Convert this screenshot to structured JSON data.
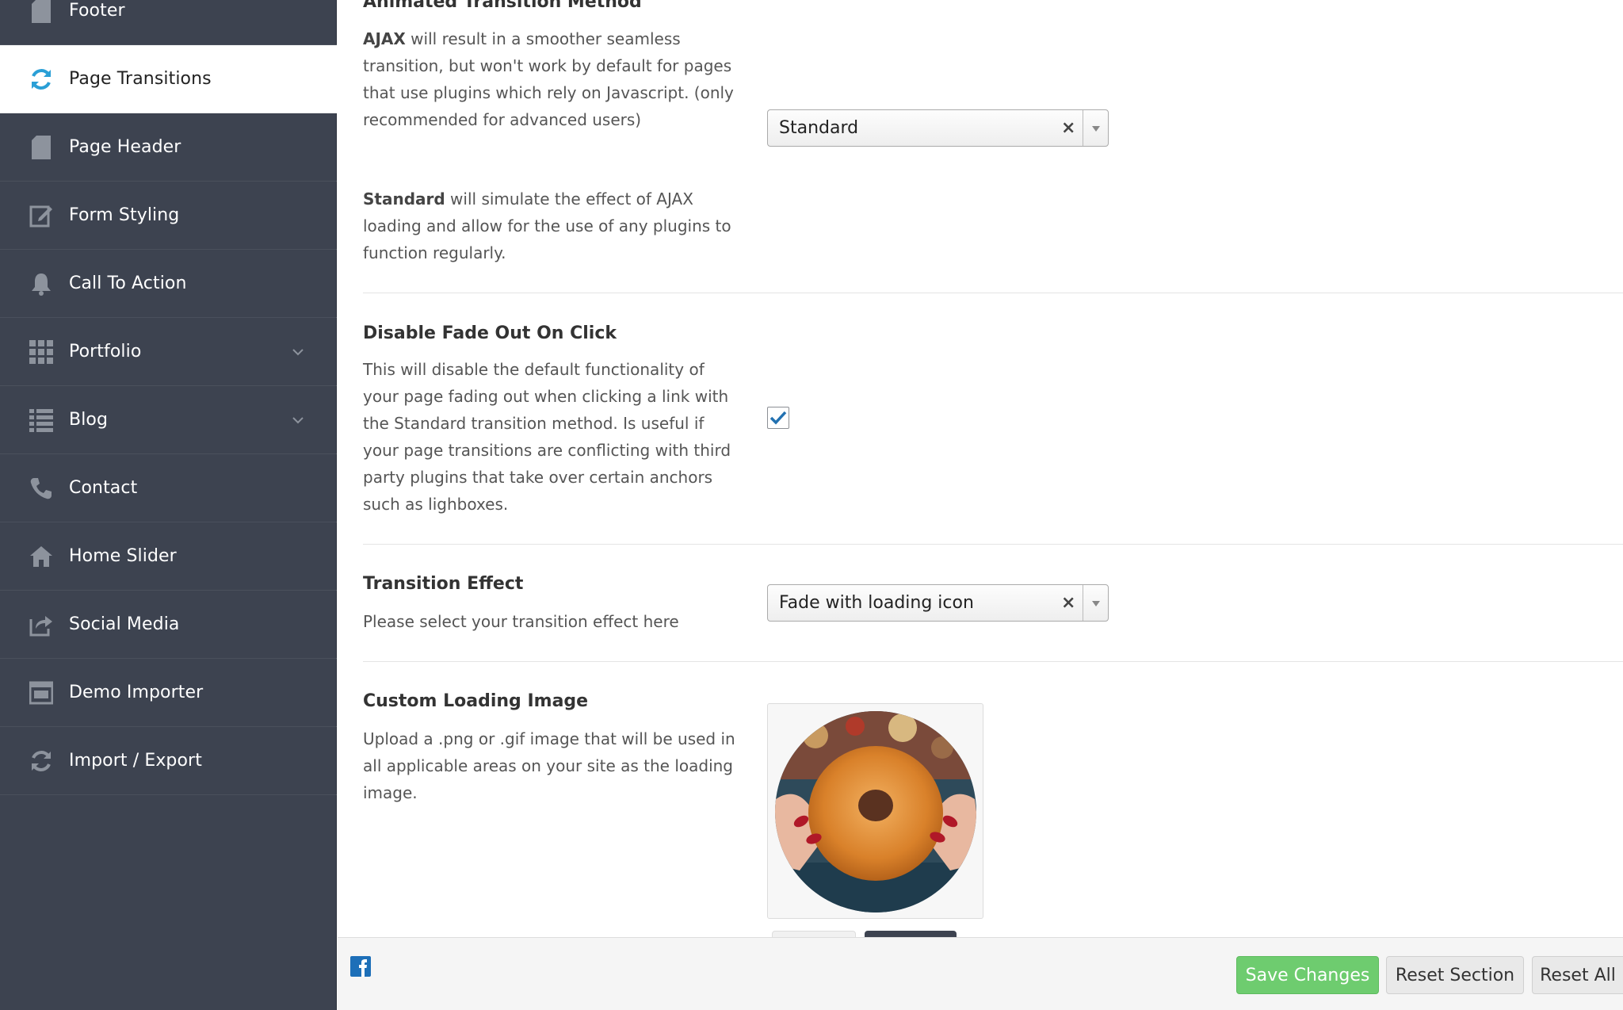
{
  "sidebar": {
    "items": [
      {
        "label": "Footer",
        "icon": "file-icon"
      },
      {
        "label": "Page Transitions",
        "icon": "refresh-icon",
        "active": true
      },
      {
        "label": "Page Header",
        "icon": "file-icon"
      },
      {
        "label": "Form Styling",
        "icon": "edit-icon"
      },
      {
        "label": "Call To Action",
        "icon": "bell-icon"
      },
      {
        "label": "Portfolio",
        "icon": "grid-icon",
        "expandable": true
      },
      {
        "label": "Blog",
        "icon": "list-icon",
        "expandable": true
      },
      {
        "label": "Contact",
        "icon": "phone-icon"
      },
      {
        "label": "Home Slider",
        "icon": "home-icon"
      },
      {
        "label": "Social Media",
        "icon": "share-icon"
      },
      {
        "label": "Demo Importer",
        "icon": "window-icon"
      },
      {
        "label": "Import / Export",
        "icon": "refresh-icon"
      }
    ]
  },
  "fields": {
    "transition_method": {
      "title": "Animated Transition Method",
      "desc_ajax_strong": "AJAX",
      "desc_ajax_rest": " will result in a smoother seamless transition, but won't work by default for pages that use plugins which rely on Javascript. (only recommended for advanced users)",
      "desc_std_strong": "Standard",
      "desc_std_rest": " will simulate the effect of AJAX loading and allow for the use of any plugins to function regularly.",
      "value": "Standard",
      "clear": "×"
    },
    "disable_fade": {
      "title": "Disable Fade Out On Click",
      "desc": "This will disable the default functionality of your page fading out when clicking a link with the Standard transition method. Is useful if your page transitions are conflicting with third party plugins that take over certain anchors such as lighboxes.",
      "checked": true
    },
    "transition_effect": {
      "title": "Transition Effect",
      "desc": "Please select your transition effect here",
      "value": "Fade with loading icon",
      "clear": "×"
    },
    "loading_image": {
      "title": "Custom Loading Image",
      "desc": "Upload a .png or .gif image that will be used in all applicable areas on your site as the loading image."
    }
  },
  "footer": {
    "social_icon": "facebook-icon",
    "save_label": "Save Changes",
    "reset_section_label": "Reset Section",
    "reset_all_label": "Reset All"
  },
  "colors": {
    "sidebar_bg": "#3d4350",
    "accent_blue": "#2a9fd6",
    "save_green": "#6ecc6f",
    "icon_gray": "#8d939d"
  }
}
